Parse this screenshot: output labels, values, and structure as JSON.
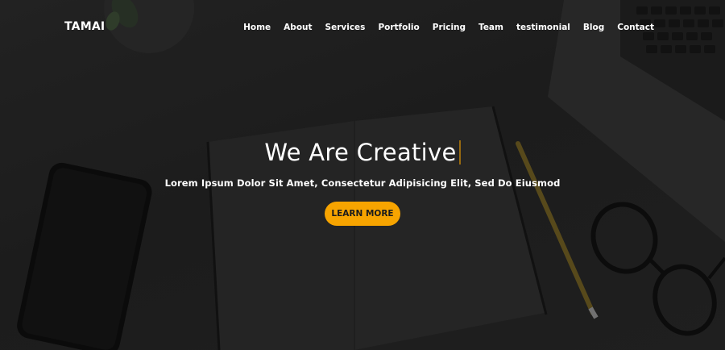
{
  "header": {
    "brand": "TAMAI",
    "nav": [
      {
        "label": "Home"
      },
      {
        "label": "About"
      },
      {
        "label": "Services"
      },
      {
        "label": "Portfolio"
      },
      {
        "label": "Pricing"
      },
      {
        "label": "Team"
      },
      {
        "label": "testimonial"
      },
      {
        "label": "Blog"
      },
      {
        "label": "Contact"
      }
    ]
  },
  "hero": {
    "title": "We Are Creative",
    "subtitle": "Lorem Ipsum Dolor Sit Amet, Consectetur Adipisicing Elit, Sed Do Eiusmod",
    "cta_label": "LEARN MORE"
  },
  "colors": {
    "accent": "#f7a400",
    "text": "#ffffff",
    "background": "#232323"
  }
}
